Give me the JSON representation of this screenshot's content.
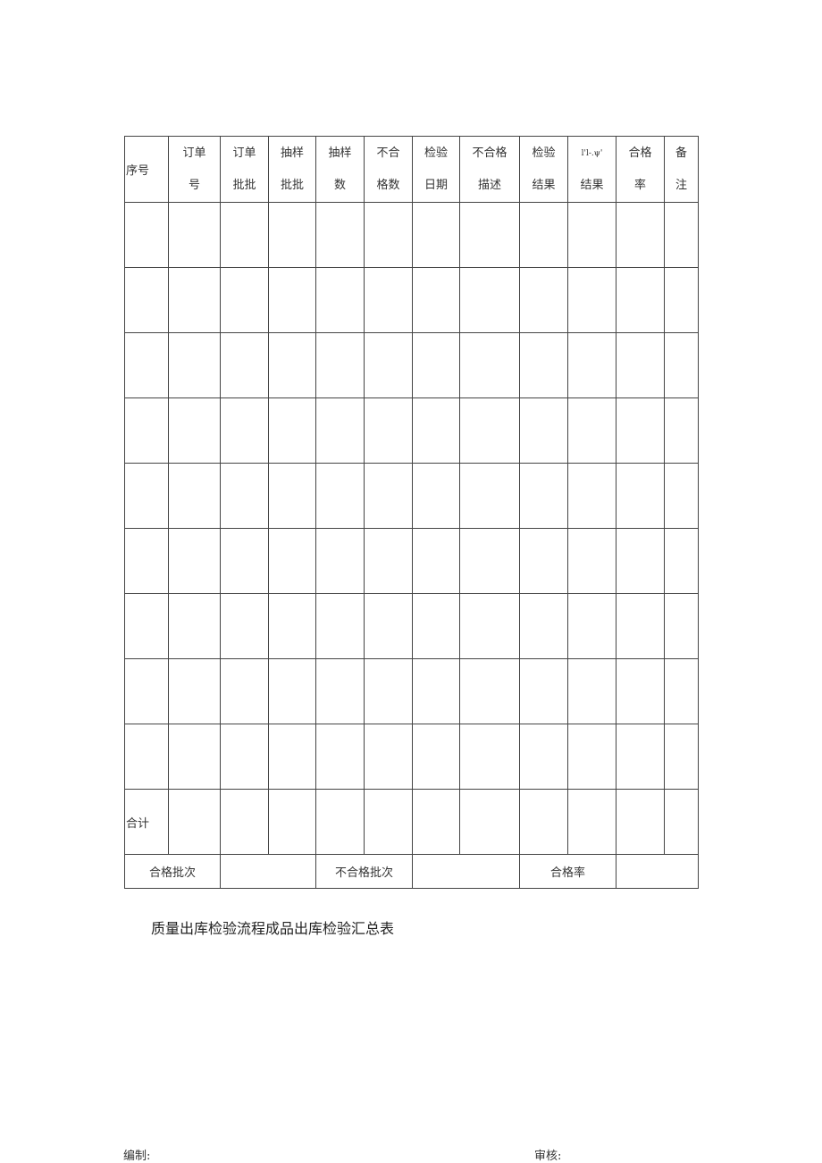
{
  "table": {
    "headers": [
      {
        "line1": "序号",
        "line2": ""
      },
      {
        "line1": "订单",
        "line2": "号"
      },
      {
        "line1": "订单",
        "line2": "批批"
      },
      {
        "line1": "抽样",
        "line2": "批批"
      },
      {
        "line1": "抽样",
        "line2": "数"
      },
      {
        "line1": "不合",
        "line2": "格数"
      },
      {
        "line1": "检验",
        "line2": "日期"
      },
      {
        "line1": "不合格",
        "line2": "描述"
      },
      {
        "line1": "检验",
        "line2": "结果"
      },
      {
        "line1": "l'l-.ψ'",
        "line2": "结果"
      },
      {
        "line1": "合格",
        "line2": "率"
      },
      {
        "line1": "备",
        "line2": "注"
      }
    ],
    "empty_row_count": 9,
    "total_row_label": "合计",
    "footer": {
      "pass_batches_label": "合格批次",
      "pass_batches_value": "",
      "fail_batches_label": "不合格批次",
      "fail_batches_value": "",
      "pass_rate_label": "合格率",
      "pass_rate_value": ""
    }
  },
  "caption": "质量出库检验流程成品出库检验汇总表",
  "signatures": {
    "prepared_by": "编制:",
    "reviewed_by": "审核:"
  }
}
